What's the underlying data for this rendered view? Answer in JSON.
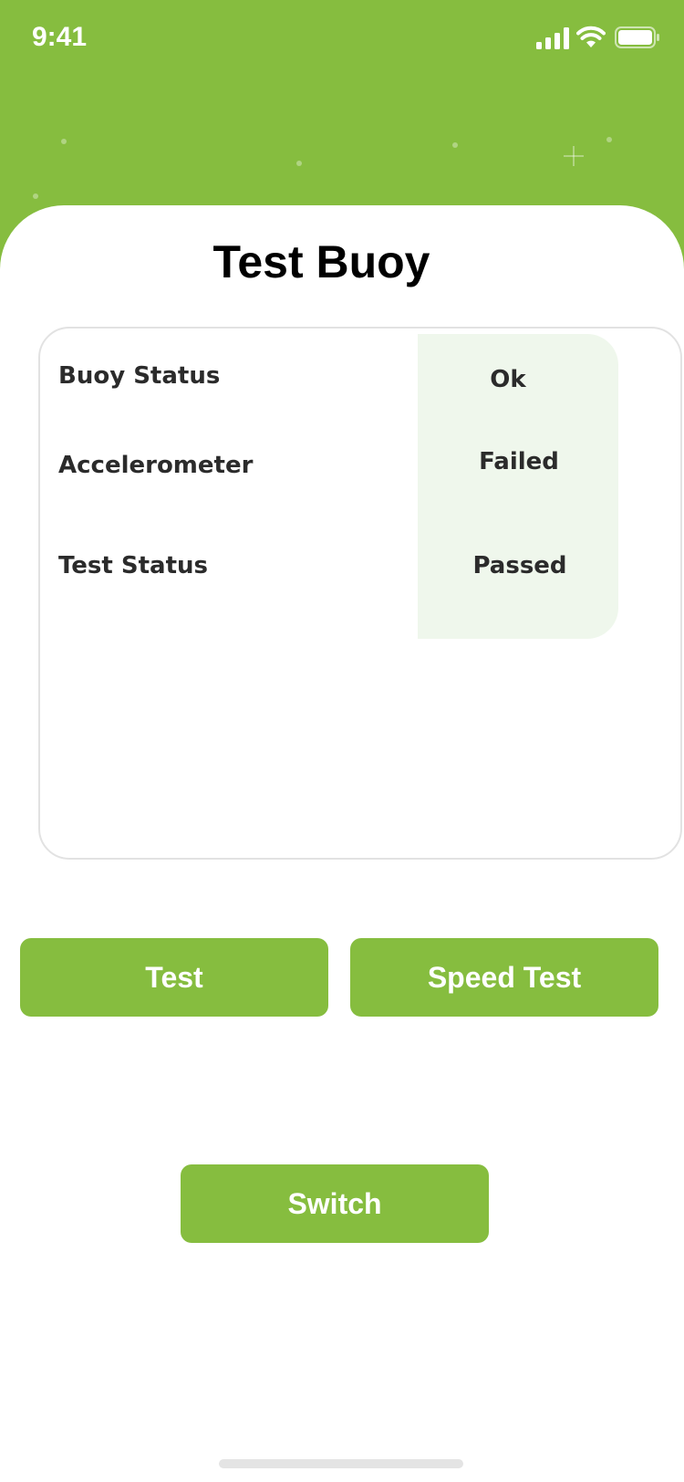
{
  "status_bar": {
    "time": "9:41"
  },
  "page": {
    "title": "Test Buoy"
  },
  "status_card": {
    "rows": [
      {
        "label": "Buoy Status",
        "value": "Ok"
      },
      {
        "label": "Accelerometer",
        "value": "Failed"
      },
      {
        "label": "Test Status",
        "value": "Passed"
      }
    ]
  },
  "actions": {
    "test_label": "Test",
    "speed_test_label": "Speed Test",
    "switch_label": "Switch"
  },
  "colors": {
    "accent": "#86bd3f",
    "value_panel": "#eff7ec",
    "text": "#2b2b2b"
  },
  "icons": [
    "signal-icon",
    "wifi-icon",
    "battery-icon"
  ]
}
